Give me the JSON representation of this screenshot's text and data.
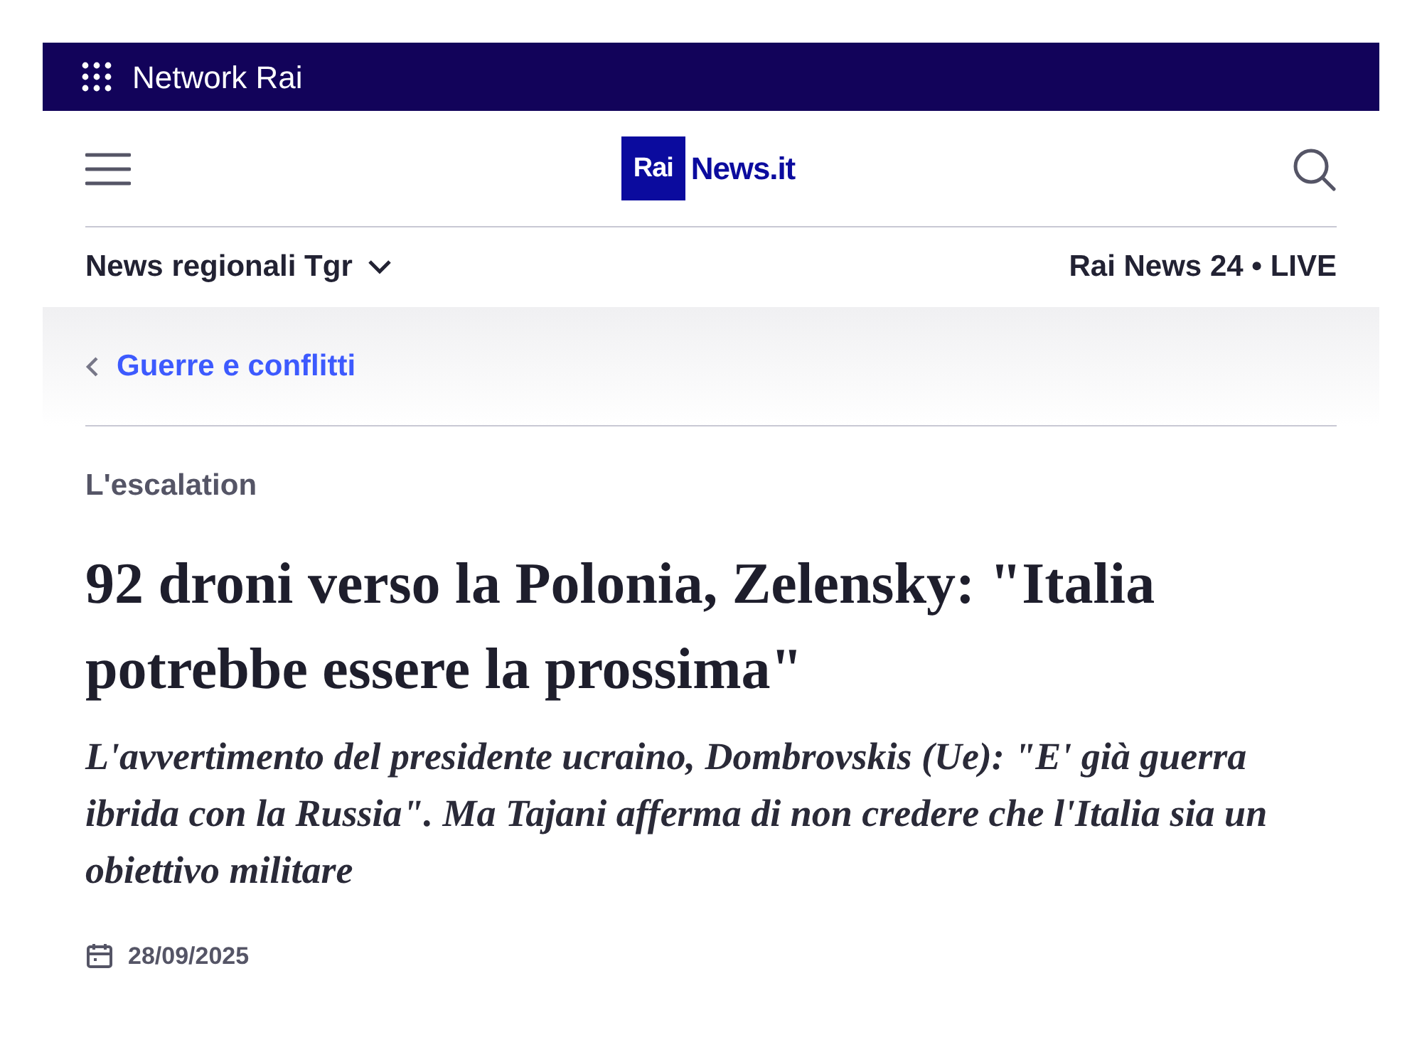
{
  "network_bar": {
    "label": "Network Rai"
  },
  "logo": {
    "badge": "Rai",
    "text": "News.it"
  },
  "nav": {
    "regional": "News regionali Tgr",
    "live": "Rai News 24 • LIVE"
  },
  "breadcrumb": {
    "label": "Guerre e conflitti"
  },
  "article": {
    "kicker": "L'escalation",
    "title": "92 droni verso la Polonia, Zelensky: \"Italia potrebbe essere la prossima\"",
    "subtitle": "L'avvertimento del presidente ucraino, Dombrovskis (Ue): \"E' già guerra ibrida con la Russia\". Ma Tajani afferma di non credere che l'Italia sia un obiettivo militare",
    "date": "28/09/2025"
  }
}
